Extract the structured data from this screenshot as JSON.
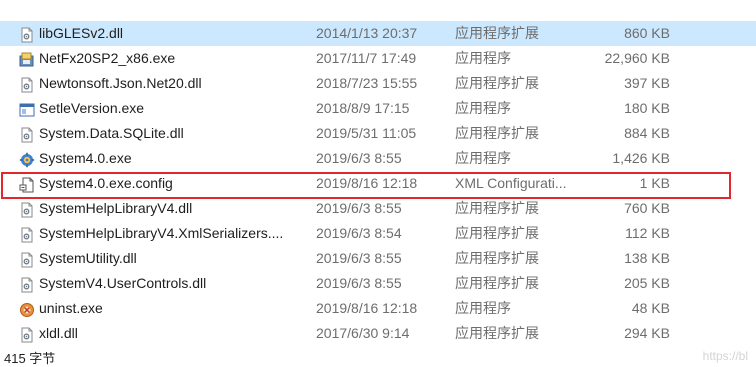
{
  "files": [
    {
      "name": "libGLESv2.dll",
      "date": "2014/1/13 20:37",
      "type": "应用程序扩展",
      "size": "860 KB",
      "icon": "dll-file-icon",
      "selected": true
    },
    {
      "name": "NetFx20SP2_x86.exe",
      "date": "2017/11/7 17:49",
      "type": "应用程序",
      "size": "22,960 KB",
      "icon": "installer-exe-icon"
    },
    {
      "name": "Newtonsoft.Json.Net20.dll",
      "date": "2018/7/23 15:55",
      "type": "应用程序扩展",
      "size": "397 KB",
      "icon": "dll-file-icon"
    },
    {
      "name": "SetleVersion.exe",
      "date": "2018/8/9 17:15",
      "type": "应用程序",
      "size": "180 KB",
      "icon": "window-exe-icon"
    },
    {
      "name": "System.Data.SQLite.dll",
      "date": "2019/5/31 11:05",
      "type": "应用程序扩展",
      "size": "884 KB",
      "icon": "dll-file-icon"
    },
    {
      "name": "System4.0.exe",
      "date": "2019/6/3 8:55",
      "type": "应用程序",
      "size": "1,426 KB",
      "icon": "gear-globe-exe-icon"
    },
    {
      "name": "System4.0.exe.config",
      "date": "2019/8/16 12:18",
      "type": "XML Configurati...",
      "size": "1 KB",
      "icon": "config-file-icon"
    },
    {
      "name": "SystemHelpLibraryV4.dll",
      "date": "2019/6/3 8:55",
      "type": "应用程序扩展",
      "size": "760 KB",
      "icon": "dll-file-icon"
    },
    {
      "name": "SystemHelpLibraryV4.XmlSerializers....",
      "date": "2019/6/3 8:54",
      "type": "应用程序扩展",
      "size": "112 KB",
      "icon": "dll-file-icon"
    },
    {
      "name": "SystemUtility.dll",
      "date": "2019/6/3 8:55",
      "type": "应用程序扩展",
      "size": "138 KB",
      "icon": "dll-file-icon"
    },
    {
      "name": "SystemV4.UserControls.dll",
      "date": "2019/6/3 8:55",
      "type": "应用程序扩展",
      "size": "205 KB",
      "icon": "dll-file-icon"
    },
    {
      "name": "uninst.exe",
      "date": "2019/8/16 12:18",
      "type": "应用程序",
      "size": "48 KB",
      "icon": "uninstaller-icon"
    },
    {
      "name": "xldl.dll",
      "date": "2017/6/30 9:14",
      "type": "应用程序扩展",
      "size": "294 KB",
      "icon": "dll-file-icon"
    }
  ],
  "status_text": "415 字节",
  "watermark": "https://bl",
  "colors": {
    "highlight_box": "#e0282e",
    "selected_row": "#cce8ff"
  }
}
